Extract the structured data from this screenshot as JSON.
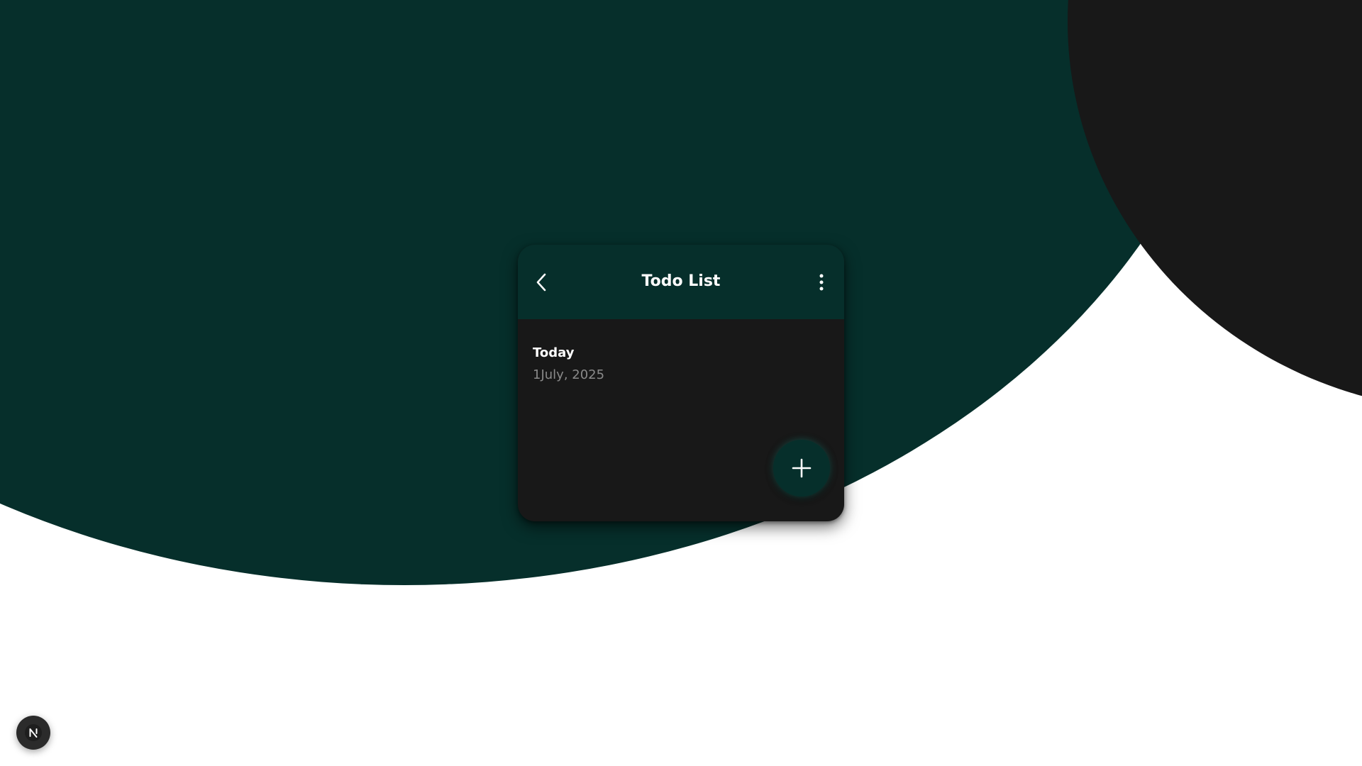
{
  "app": {
    "title": "Todo List"
  },
  "header": {
    "back_icon": "chevron-left-icon",
    "menu_icon": "more-vertical-icon"
  },
  "section": {
    "label": "Today",
    "date": "1July, 2025"
  },
  "fab": {
    "icon": "plus-icon"
  },
  "badge": {
    "icon": "n-logo-icon"
  },
  "colors": {
    "primary_green": "#062f2b",
    "card_dark": "#181818",
    "background": "#ffffff",
    "muted_text": "#8a8a8a"
  }
}
